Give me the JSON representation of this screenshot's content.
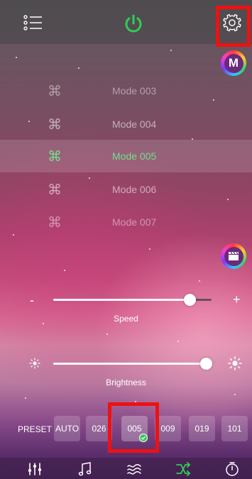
{
  "topbar": {
    "menu_icon": "list-menu-icon",
    "power_icon": "power-icon",
    "power_color": "#2fce55",
    "settings_icon": "gear-icon"
  },
  "badges": {
    "mode_badge_letter": "M",
    "scene_badge_icon": "clapperboard-icon"
  },
  "modes": [
    {
      "icon": "command-icon",
      "label": "Mode 003",
      "state": "faded"
    },
    {
      "icon": "command-icon",
      "label": "Mode 004",
      "state": "normal"
    },
    {
      "icon": "command-icon",
      "label": "Mode 005",
      "state": "selected"
    },
    {
      "icon": "command-icon",
      "label": "Mode 006",
      "state": "normal"
    },
    {
      "icon": "command-icon",
      "label": "Mode 007",
      "state": "faded"
    }
  ],
  "speed": {
    "label": "Speed",
    "minus": "-",
    "plus": "+",
    "value_fraction": 0.86
  },
  "brightness": {
    "label": "Brightness",
    "value_fraction": 1.0
  },
  "presets": {
    "label": "PRESET",
    "items": [
      "AUTO",
      "026",
      "005",
      "009",
      "019",
      "101"
    ],
    "selected": "005"
  },
  "bottom_nav": [
    "equalizer-icon",
    "music-note-icon",
    "wind-icon",
    "shuffle-icon",
    "timer-icon"
  ],
  "colors": {
    "accent_green": "#6fe08a",
    "highlight_red": "#ee1111"
  }
}
